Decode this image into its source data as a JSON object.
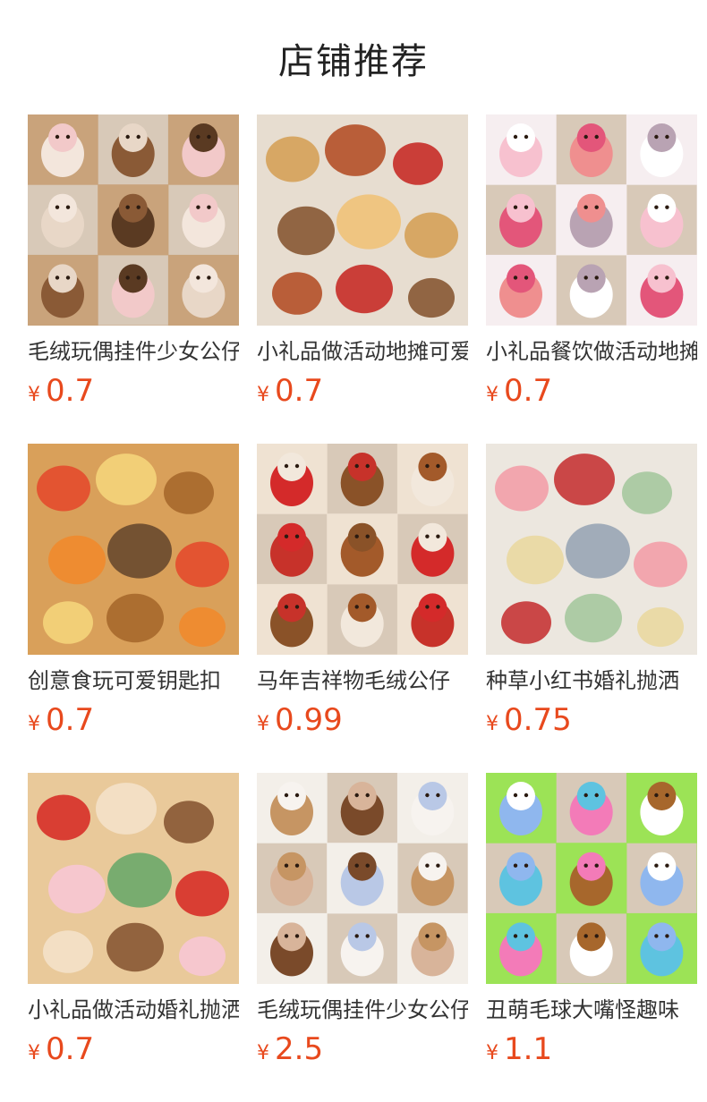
{
  "header": {
    "title": "店铺推荐"
  },
  "currency": "¥",
  "products": [
    {
      "name": "毛绒玩偶挂件少女公仔",
      "price": "0.7",
      "image": "plush-bear-bunny-grid-image",
      "palette": [
        "#c9a37b",
        "#f3e6dc",
        "#8a5a36",
        "#f2c9c9",
        "#e8d7c7",
        "#5a3a22"
      ]
    },
    {
      "name": "小礼品做活动地摊可爱",
      "price": "0.7",
      "image": "food-plush-keychains-on-plate-image",
      "palette": [
        "#e7ddd0",
        "#d6a25a",
        "#b5532b",
        "#c8302a",
        "#8a5a36",
        "#f0c27a"
      ]
    },
    {
      "name": "小礼品餐饮做活动地摊",
      "price": "0.7",
      "image": "fluffy-plush-pendants-grid-image",
      "palette": [
        "#f6eef0",
        "#f7c1cf",
        "#ef8f8f",
        "#ffffff",
        "#e3567a",
        "#b9a3b3"
      ]
    },
    {
      "name": "创意食玩可爱钥匙扣",
      "price": "0.7",
      "image": "food-plush-trays-image",
      "palette": [
        "#d9a05a",
        "#e44d2e",
        "#f4d27a",
        "#a8692d",
        "#f08a2e",
        "#6b4b2f"
      ]
    },
    {
      "name": "马年吉祥物毛绒公仔",
      "price": "0.99",
      "image": "horse-mascot-plush-grid-image",
      "palette": [
        "#efe2d2",
        "#d42a2a",
        "#8a5228",
        "#f2e8dc",
        "#c7322a",
        "#a35a2a"
      ]
    },
    {
      "name": "种草小红书婚礼抛洒",
      "price": "0.75",
      "image": "wedding-gift-bags-image",
      "palette": [
        "#ece7df",
        "#f2a1a9",
        "#c73a3a",
        "#a7c9a0",
        "#e9d9a2",
        "#9aa7b5"
      ]
    },
    {
      "name": "小礼品做活动婚礼抛洒",
      "price": "0.7",
      "image": "packed-plush-pendants-image",
      "palette": [
        "#e9c99a",
        "#d7322a",
        "#f3e1c8",
        "#8a5a36",
        "#f6c7d2",
        "#6ea96b"
      ]
    },
    {
      "name": "毛绒玩偶挂件少女公仔",
      "price": "2.5",
      "image": "plush-dogs-bunnies-grid-image",
      "palette": [
        "#f3efe9",
        "#c69563",
        "#7a4a2a",
        "#f7f3ef",
        "#d8b49a",
        "#b9c8e6"
      ]
    },
    {
      "name": "丑萌毛球大嘴怪趣味",
      "price": "1.1",
      "image": "ugly-cute-furball-grid-image",
      "palette": [
        "#9ce356",
        "#8fb7ee",
        "#f37bb8",
        "#ffffff",
        "#5ec3e0",
        "#a7672c"
      ]
    }
  ]
}
